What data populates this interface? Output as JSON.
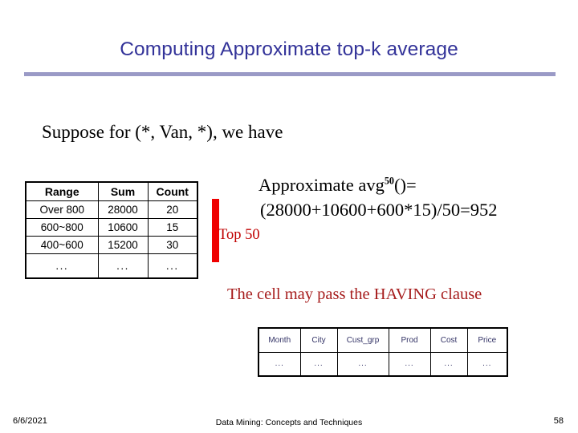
{
  "slide": {
    "title": "Computing Approximate top-k average",
    "rule_color": "#9a9ac6",
    "title_color": "#333399"
  },
  "body": {
    "suppose_line": "Suppose for (*, Van, *), we have",
    "having_text": "The cell may pass the HAVING clause",
    "top50_label": "Top 50",
    "red_marker_color": "#ef0000"
  },
  "formula": {
    "line1_prefix": "Approximate avg",
    "line1_superscript": "50",
    "line1_suffix": "()=",
    "line2": "(28000+10600+600*15)/50=952"
  },
  "range_table": {
    "headers": [
      "Range",
      "Sum",
      "Count"
    ],
    "rows": [
      [
        "Over 800",
        "28000",
        "20"
      ],
      [
        "600~800",
        "10600",
        "15"
      ],
      [
        "400~600",
        "15200",
        "30"
      ],
      [
        "...",
        "...",
        "..."
      ]
    ]
  },
  "schema_table": {
    "headers": [
      "Month",
      "City",
      "Cust_grp",
      "Prod",
      "Cost",
      "Price"
    ],
    "rows": [
      [
        "...",
        "...",
        "...",
        "...",
        "...",
        "..."
      ]
    ]
  },
  "footer": {
    "date": "6/6/2021",
    "center": "Data Mining: Concepts and Techniques",
    "page": "58"
  }
}
